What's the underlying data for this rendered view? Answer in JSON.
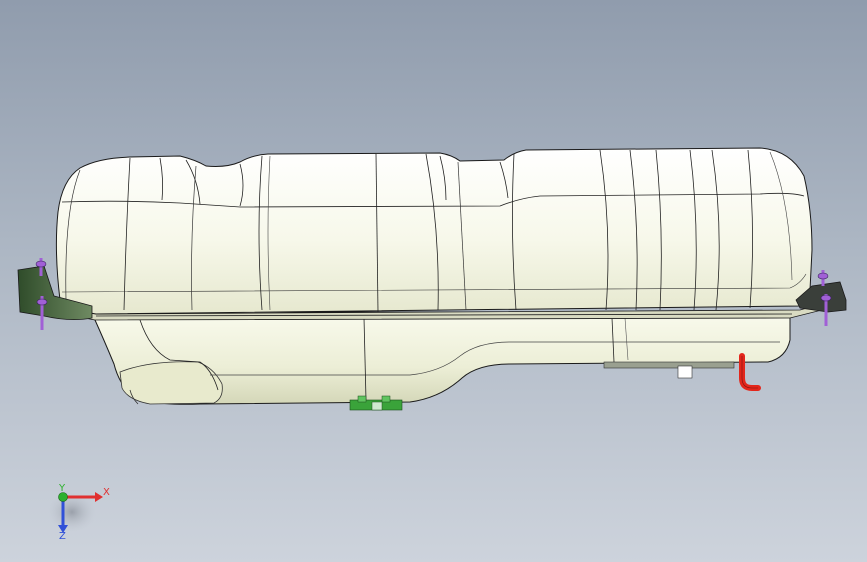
{
  "view": {
    "background_top": "#909cad",
    "background_bottom": "#cdd3dc"
  },
  "model": {
    "tank_body_color": "#fdfdf0",
    "bracket_color": "#3e5e36",
    "bolt_color": "#a160d6",
    "pipe_color": "#e3261b",
    "clip_color": "#3aa33a"
  },
  "triad": {
    "x_label": "X",
    "y_label": "Y",
    "z_label": "Z",
    "x_color": "#e03030",
    "y_color": "#2db12d",
    "z_color": "#3050d8"
  }
}
